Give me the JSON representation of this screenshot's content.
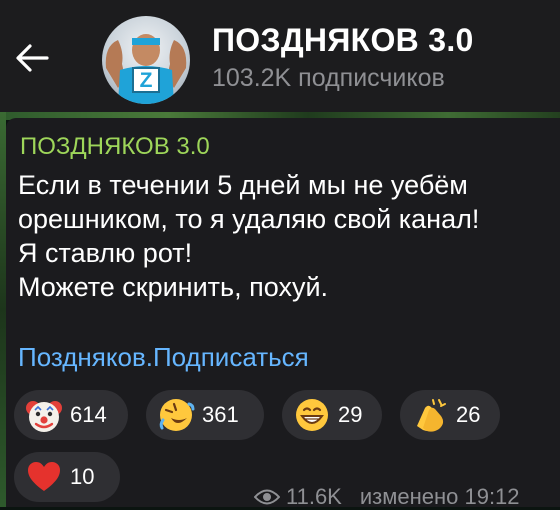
{
  "header": {
    "title": "ПОЗДНЯКОВ 3.0",
    "subscribers": "103.2K подписчиков"
  },
  "message": {
    "author": "ПОЗДНЯКОВ 3.0",
    "lines": [
      "Если в течении 5 дней мы не уебём",
      "орешником, то я удаляю свой канал!",
      "Я ставлю рот!",
      "Можете скринить, похуй."
    ],
    "link_text": "Поздняков.Подписаться",
    "reactions": [
      {
        "emoji": "clown-face",
        "count": "614"
      },
      {
        "emoji": "rolling-on-floor-laughing",
        "count": "361"
      },
      {
        "emoji": "grinning-face",
        "count": "29"
      },
      {
        "emoji": "clapping-hands",
        "count": "26"
      },
      {
        "emoji": "red-heart",
        "count": "10"
      }
    ],
    "views": "11.6K",
    "edited_time": "изменено 19:12"
  },
  "colors": {
    "author": "#9ed65a",
    "link": "#66b6ff",
    "bubble": "#1b1b1e",
    "header": "#1c1c1e"
  }
}
